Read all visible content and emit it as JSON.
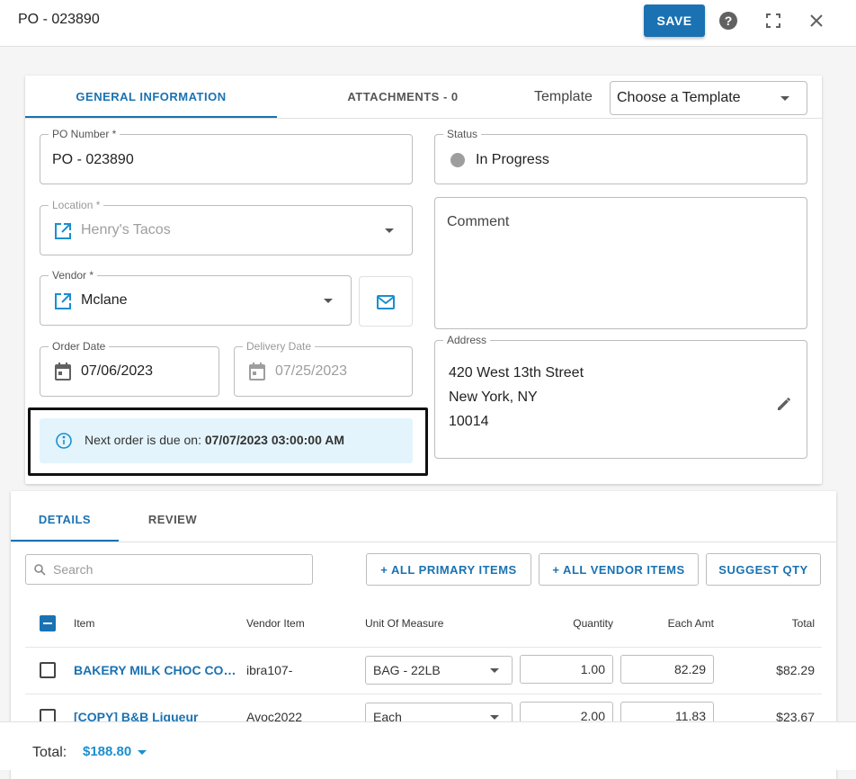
{
  "header": {
    "title": "PO - 023890",
    "save_label": "SAVE",
    "icons": [
      "help-icon",
      "fullscreen-icon",
      "close-icon"
    ]
  },
  "general": {
    "tabs": [
      {
        "label": "GENERAL INFORMATION",
        "active": true
      },
      {
        "label": "ATTACHMENTS - 0",
        "active": false
      }
    ],
    "template_label": "Template",
    "template_value": "Choose a Template",
    "po_number": {
      "label": "PO Number *",
      "value": "PO - 023890"
    },
    "status": {
      "label": "Status",
      "value": "In Progress",
      "dot_color": "#9e9e9e"
    },
    "location": {
      "label": "Location *",
      "value": "Henry's Tacos"
    },
    "comment": {
      "placeholder": "Comment"
    },
    "vendor": {
      "label": "Vendor *",
      "value": "Mclane"
    },
    "order_date": {
      "label": "Order Date",
      "value": "07/06/2023"
    },
    "delivery_date": {
      "label": "Delivery Date",
      "value": "07/25/2023"
    },
    "address": {
      "label": "Address",
      "line1": "420 West 13th Street",
      "line2": "New York, NY",
      "line3": "10014"
    },
    "next_order": {
      "prefix": "Next order is due on: ",
      "value": "07/07/2023 03:00:00 AM"
    }
  },
  "details": {
    "tabs": [
      {
        "label": "DETAILS",
        "active": true
      },
      {
        "label": "REVIEW",
        "active": false
      }
    ],
    "search_placeholder": "Search",
    "buttons": {
      "all_primary": "+ ALL PRIMARY ITEMS",
      "all_vendor": "+ ALL VENDOR ITEMS",
      "suggest_qty": "SUGGEST QTY"
    },
    "columns": {
      "item": "Item",
      "vendor_item": "Vendor Item",
      "uom": "Unit Of Measure",
      "quantity": "Quantity",
      "each_amt": "Each Amt",
      "total": "Total"
    },
    "rows": [
      {
        "item": "BAKERY MILK CHOC COUVERTURE",
        "vendor_item": "ibra107-",
        "uom": "BAG - 22LB",
        "quantity": "1.00",
        "each_amt": "82.29",
        "total": "$82.29"
      },
      {
        "item": "[COPY] B&B Liqueur",
        "vendor_item": "Avoc2022",
        "uom": "Each",
        "quantity": "2.00",
        "each_amt": "11.83",
        "total": "$23.67"
      }
    ]
  },
  "footer": {
    "total_label": "Total:",
    "total_value": "$188.80"
  },
  "colors": {
    "accent": "#1a72b2",
    "info_bg": "#e3f4fc"
  }
}
